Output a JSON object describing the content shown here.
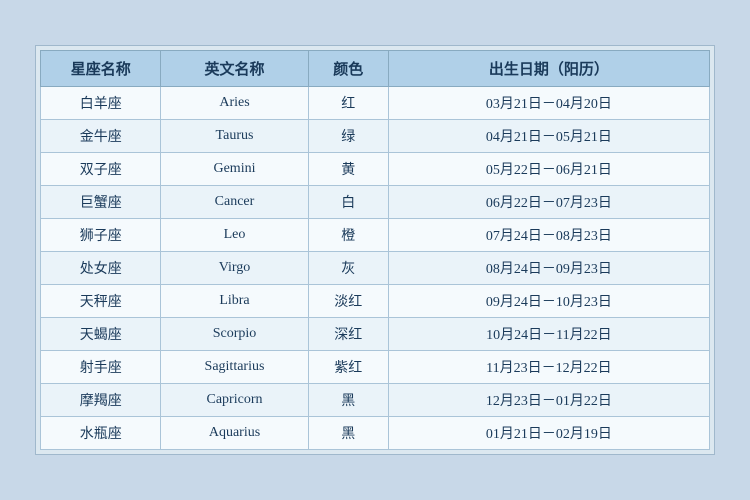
{
  "table": {
    "headers": {
      "chinese_name": "星座名称",
      "english_name": "英文名称",
      "color": "颜色",
      "birth_date": "出生日期（阳历）"
    },
    "rows": [
      {
        "chinese": "白羊座",
        "english": "Aries",
        "color": "红",
        "date": "03月21日－04月20日"
      },
      {
        "chinese": "金牛座",
        "english": "Taurus",
        "color": "绿",
        "date": "04月21日－05月21日"
      },
      {
        "chinese": "双子座",
        "english": "Gemini",
        "color": "黄",
        "date": "05月22日－06月21日"
      },
      {
        "chinese": "巨蟹座",
        "english": "Cancer",
        "color": "白",
        "date": "06月22日－07月23日"
      },
      {
        "chinese": "狮子座",
        "english": "Leo",
        "color": "橙",
        "date": "07月24日－08月23日"
      },
      {
        "chinese": "处女座",
        "english": "Virgo",
        "color": "灰",
        "date": "08月24日－09月23日"
      },
      {
        "chinese": "天秤座",
        "english": "Libra",
        "color": "淡红",
        "date": "09月24日－10月23日"
      },
      {
        "chinese": "天蝎座",
        "english": "Scorpio",
        "color": "深红",
        "date": "10月24日－11月22日"
      },
      {
        "chinese": "射手座",
        "english": "Sagittarius",
        "color": "紫红",
        "date": "11月23日－12月22日"
      },
      {
        "chinese": "摩羯座",
        "english": "Capricorn",
        "color": "黑",
        "date": "12月23日－01月22日"
      },
      {
        "chinese": "水瓶座",
        "english": "Aquarius",
        "color": "黑",
        "date": "01月21日－02月19日"
      }
    ]
  }
}
